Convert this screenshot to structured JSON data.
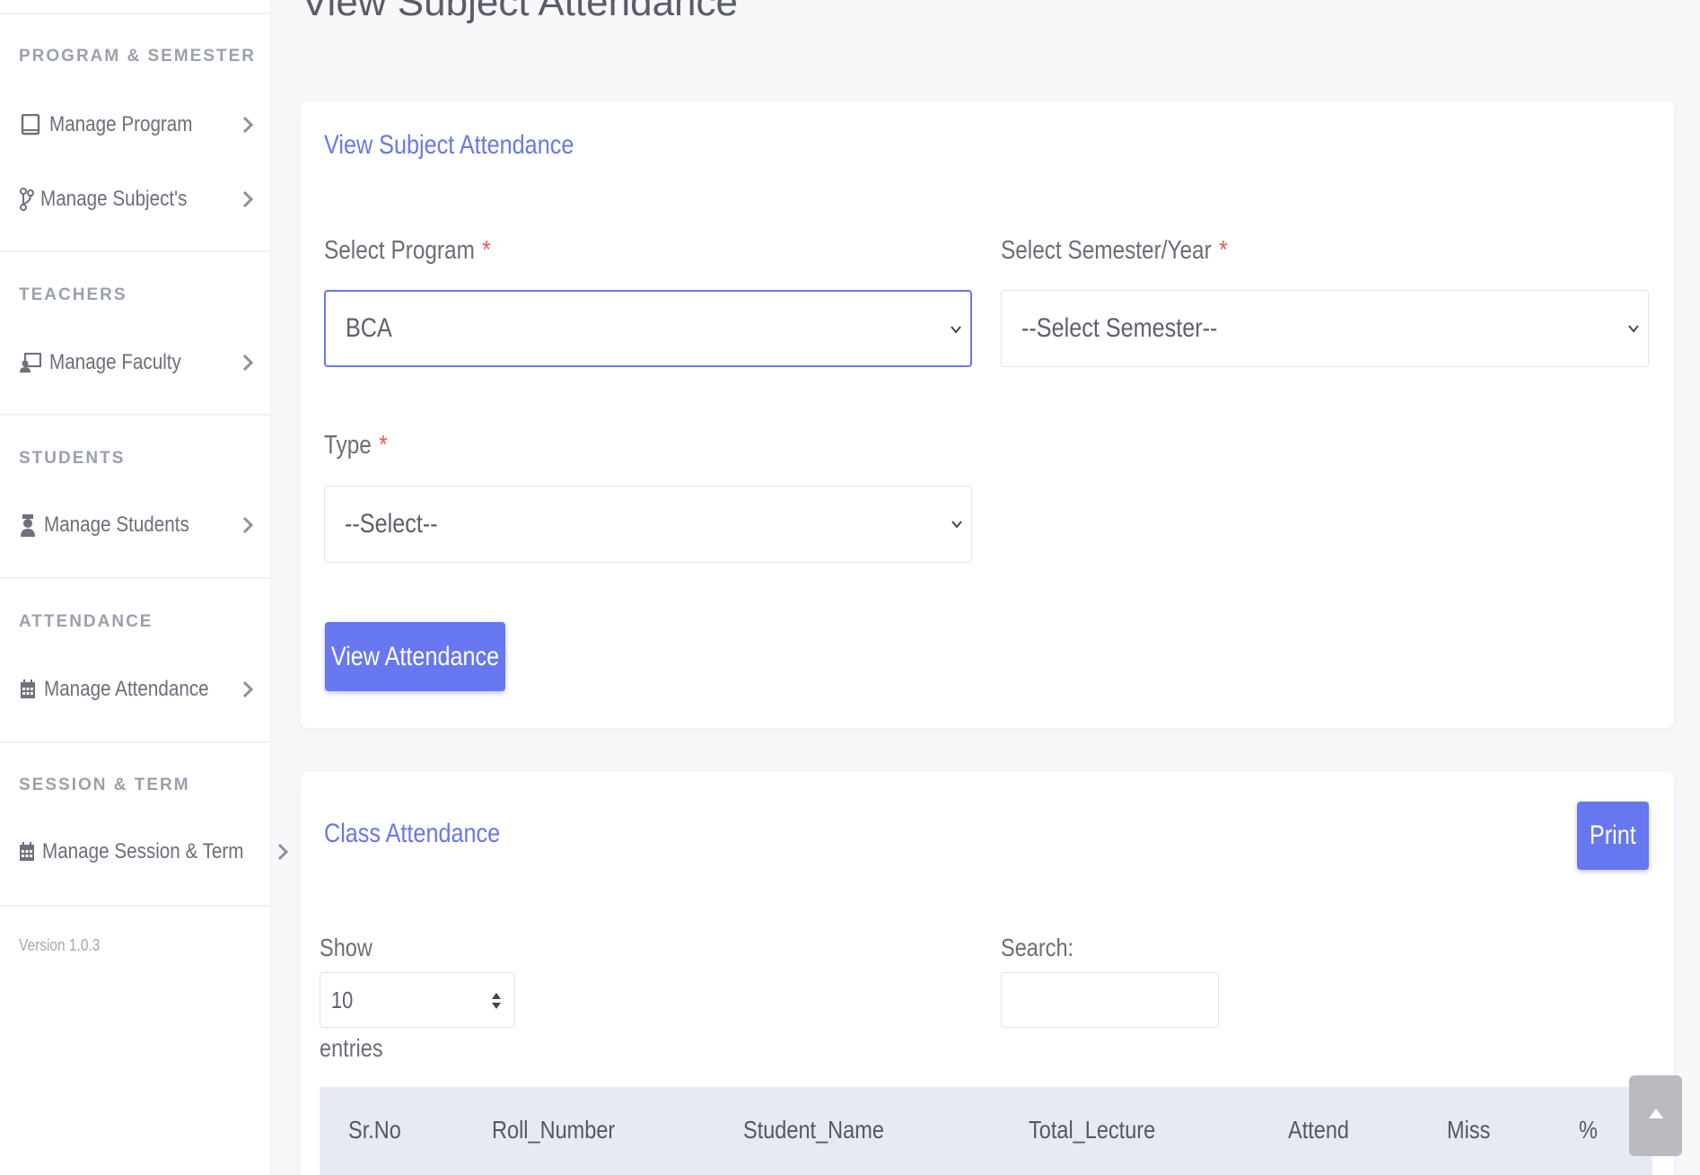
{
  "page": {
    "title": "View Subject Attendance"
  },
  "sidebar": {
    "sections": [
      {
        "heading": "PROGRAM & SEMESTER",
        "items": [
          {
            "label": "Manage Program",
            "icon": "tablet-icon"
          },
          {
            "label": "Manage Subject's",
            "icon": "branch-icon"
          }
        ]
      },
      {
        "heading": "TEACHERS",
        "items": [
          {
            "label": "Manage Faculty",
            "icon": "chalkboard-teacher-icon"
          }
        ]
      },
      {
        "heading": "STUDENTS",
        "items": [
          {
            "label": "Manage Students",
            "icon": "user-graduate-icon"
          }
        ]
      },
      {
        "heading": "ATTENDANCE",
        "items": [
          {
            "label": "Manage Attendance",
            "icon": "calendar-icon"
          }
        ]
      },
      {
        "heading": "SESSION & TERM",
        "items": [
          {
            "label": "Manage Session & Term",
            "icon": "calendar-icon"
          }
        ]
      }
    ],
    "version": "Version 1.0.3"
  },
  "form_card": {
    "title": "View Subject Attendance",
    "program_label": "Select Program",
    "program_value": "BCA",
    "semester_label": "Select Semester/Year",
    "semester_value": "--Select Semester--",
    "type_label": "Type",
    "type_value": "--Select--",
    "required_mark": "*",
    "submit_label": "View Attendance"
  },
  "attendance_card": {
    "title": "Class Attendance",
    "print_label": "Print",
    "show_label": "Show",
    "entries_value": "10",
    "entries_label": "entries",
    "search_label": "Search:",
    "search_value": "",
    "columns": [
      "Sr.No",
      "Roll_Number",
      "Student_Name",
      "Total_Lecture",
      "Attend",
      "Miss",
      "%"
    ]
  },
  "colors": {
    "accent": "#6777ef",
    "required": "#fc544b",
    "table_header_bg": "#e7eaf3"
  }
}
